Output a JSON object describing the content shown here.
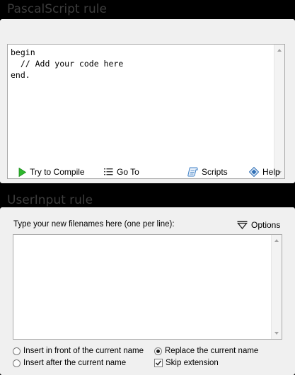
{
  "pascal": {
    "title": "PascalScript rule",
    "code": "begin\n  // Add your code here\nend.",
    "toolbar": {
      "compile_label": "Try to Compile",
      "goto_label": "Go To",
      "scripts_label": "Scripts",
      "help_label": "Help"
    }
  },
  "userinput": {
    "title": "UserInput rule",
    "instruction": "Type your new filenames here (one per line):",
    "options_label": "Options",
    "names_value": "",
    "options": {
      "insert_front_label": "Insert in front of the current name",
      "insert_after_label": "Insert after the current name",
      "replace_label": "Replace the current name",
      "skip_ext_label": "Skip extension",
      "selected_mode": "replace",
      "skip_extension_checked": true
    }
  },
  "colors": {
    "compile_green": "#2db82d",
    "help_blue": "#2f6fb5",
    "scripts_blue": "#3d7fc4"
  }
}
